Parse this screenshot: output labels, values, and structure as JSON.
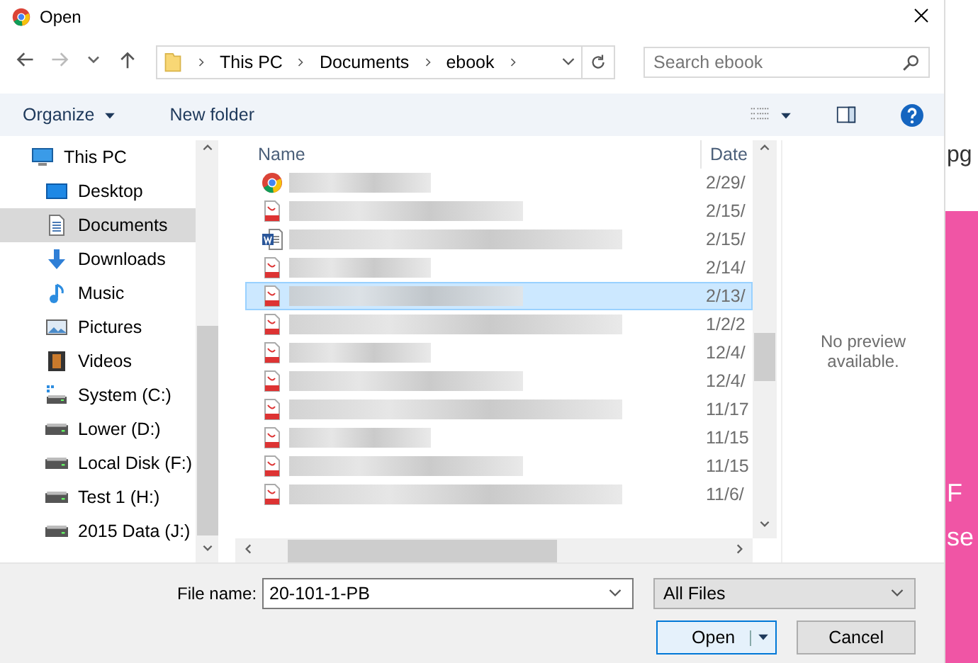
{
  "window": {
    "title": "Open"
  },
  "address": {
    "path": [
      "This PC",
      "Documents",
      "ebook"
    ]
  },
  "search": {
    "placeholder": "Search ebook"
  },
  "toolbar": {
    "organize": "Organize",
    "new_folder": "New folder"
  },
  "nav": {
    "items": [
      {
        "label": "This PC",
        "kind": "pc",
        "selected": false,
        "children": [
          {
            "label": "Desktop",
            "kind": "desktop",
            "selected": false
          },
          {
            "label": "Documents",
            "kind": "documents",
            "selected": true
          },
          {
            "label": "Downloads",
            "kind": "downloads",
            "selected": false
          },
          {
            "label": "Music",
            "kind": "music",
            "selected": false
          },
          {
            "label": "Pictures",
            "kind": "pictures",
            "selected": false
          },
          {
            "label": "Videos",
            "kind": "videos",
            "selected": false
          },
          {
            "label": "System (C:)",
            "kind": "system",
            "selected": false
          },
          {
            "label": "Lower (D:)",
            "kind": "drive",
            "selected": false
          },
          {
            "label": "Local Disk (F:)",
            "kind": "drive",
            "selected": false
          },
          {
            "label": "Test 1 (H:)",
            "kind": "drive",
            "selected": false
          },
          {
            "label": "2015 Data (J:)",
            "kind": "drive",
            "selected": false
          }
        ]
      }
    ]
  },
  "file_list": {
    "columns": [
      "Name",
      "Date"
    ],
    "rows": [
      {
        "kind": "chrome",
        "date": "2/29/",
        "selected": false
      },
      {
        "kind": "pdf",
        "date": "2/15/",
        "selected": false
      },
      {
        "kind": "word",
        "date": "2/15/",
        "selected": false
      },
      {
        "kind": "pdf",
        "date": "2/14/",
        "selected": false
      },
      {
        "kind": "pdf",
        "date": "2/13/",
        "selected": true
      },
      {
        "kind": "pdf",
        "date": "1/2/2",
        "selected": false
      },
      {
        "kind": "pdf",
        "date": "12/4/",
        "selected": false
      },
      {
        "kind": "pdf",
        "date": "12/4/",
        "selected": false
      },
      {
        "kind": "pdf",
        "date": "11/17",
        "selected": false
      },
      {
        "kind": "pdf",
        "date": "11/15",
        "selected": false
      },
      {
        "kind": "pdf",
        "date": "11/15",
        "selected": false
      },
      {
        "kind": "pdf",
        "date": "11/6/",
        "selected": false
      }
    ]
  },
  "preview": {
    "message": "No preview available."
  },
  "file_name": {
    "label": "File name:",
    "value": "20-101-1-PB"
  },
  "file_type": {
    "value": "All Files"
  },
  "buttons": [
    {
      "label": "Open",
      "kind": "split"
    },
    {
      "label": "Cancel",
      "kind": "plain"
    }
  ],
  "background_page": {
    "texts": [
      "pg",
      "F",
      "se"
    ]
  }
}
